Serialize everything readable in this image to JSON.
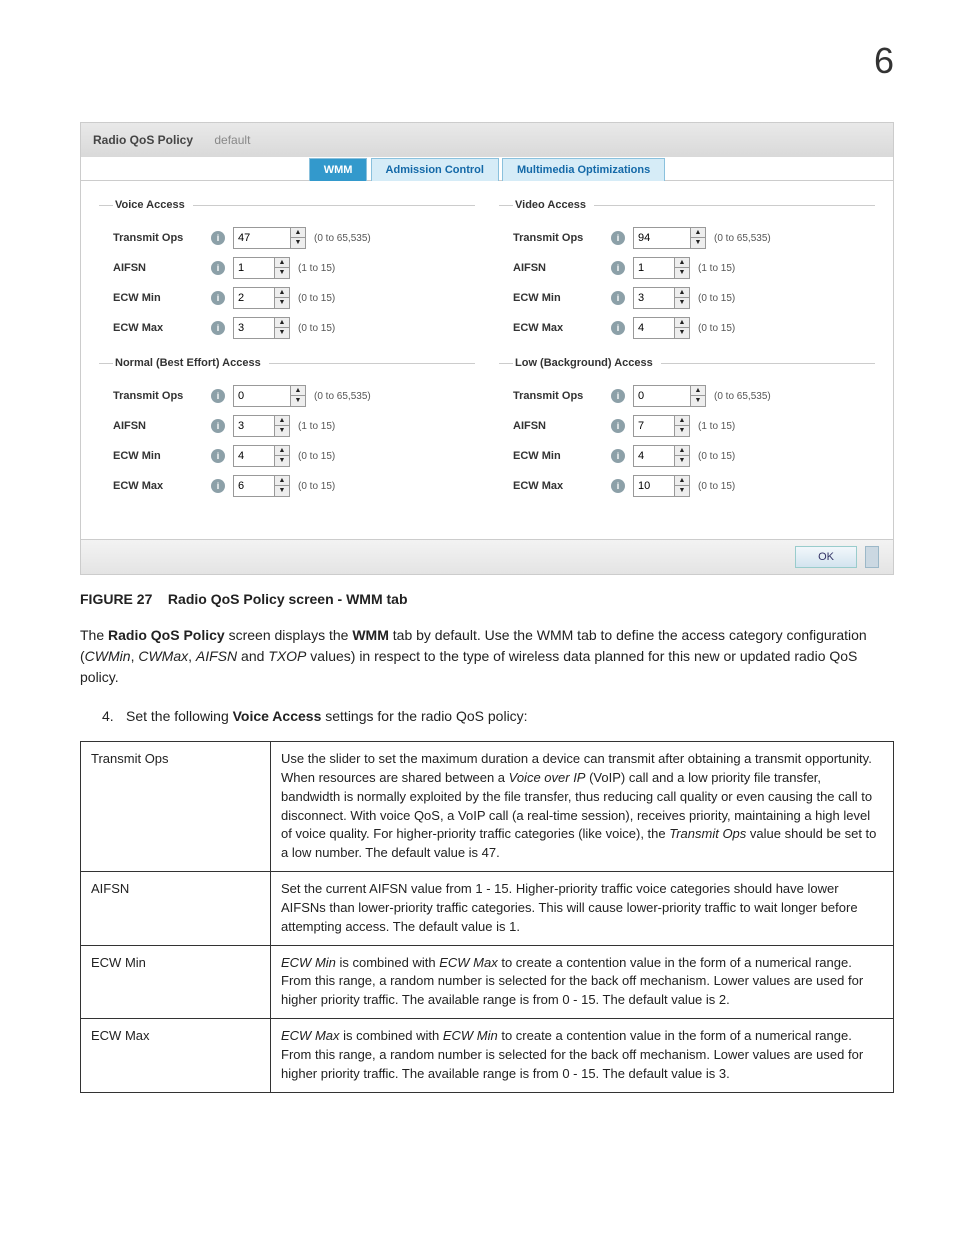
{
  "page_number": "6",
  "screenshot": {
    "title_label": "Radio QoS Policy",
    "title_value": "default",
    "tabs": {
      "wmm": "WMM",
      "admission": "Admission Control",
      "multimedia": "Multimedia Optimizations"
    },
    "hints": {
      "r65535": "(0 to 65,535)",
      "r15_1": "(1 to 15)",
      "r15_0": "(0 to 15)"
    },
    "legends": {
      "voice": "Voice Access",
      "normal": "Normal (Best Effort) Access",
      "video": "Video Access",
      "low": "Low (Background) Access"
    },
    "labels": {
      "transmit": "Transmit Ops",
      "aifsn": "AIFSN",
      "ecwmin": "ECW Min",
      "ecwmax": "ECW Max"
    },
    "values": {
      "voice": {
        "transmit": "47",
        "aifsn": "1",
        "ecwmin": "2",
        "ecwmax": "3"
      },
      "normal": {
        "transmit": "0",
        "aifsn": "3",
        "ecwmin": "4",
        "ecwmax": "6"
      },
      "video": {
        "transmit": "94",
        "aifsn": "1",
        "ecwmin": "3",
        "ecwmax": "4"
      },
      "low": {
        "transmit": "0",
        "aifsn": "7",
        "ecwmin": "4",
        "ecwmax": "10"
      }
    },
    "ok_button": "OK"
  },
  "figure": {
    "label": "FIGURE 27",
    "caption": "Radio QoS Policy screen - WMM tab"
  },
  "paragraph": {
    "p1a": "The ",
    "p1b": "Radio QoS Policy",
    "p1c": " screen displays the ",
    "p1d": "WMM",
    "p1e": " tab by default. Use the WMM tab to define the access category configuration (",
    "p1f": "CWMin",
    "p1g": ", ",
    "p1h": "CWMax",
    "p1i": ", ",
    "p1j": "AIFSN",
    "p1k": " and ",
    "p1l": "TXOP",
    "p1m": " values) in respect to the type of wireless data planned for this new or updated radio QoS policy."
  },
  "step4": {
    "num": "4.",
    "a": "Set the following ",
    "b": "Voice Access",
    "c": " settings for the radio QoS policy:"
  },
  "table": {
    "r1": {
      "term": "Transmit Ops",
      "a": "Use the slider to set the maximum duration a device can transmit after obtaining a transmit opportunity. When resources are shared between a ",
      "b": "Voice over IP",
      "c": " (VoIP) call and a low priority file transfer, bandwidth is normally exploited by the file transfer, thus reducing call quality or even causing the call to disconnect. With voice QoS, a VoIP call (a real-time session), receives priority, maintaining a high level of voice quality. For higher-priority traffic categories (like voice), the ",
      "d": "Transmit Ops",
      "e": " value should be set to a low number. The default value is 47."
    },
    "r2": {
      "term": "AIFSN",
      "text": "Set the current AIFSN value from 1 - 15. Higher-priority traffic voice categories should have lower AIFSNs than lower-priority traffic categories. This will cause lower-priority traffic to wait longer before attempting access. The default value is 1."
    },
    "r3": {
      "term": "ECW Min",
      "a": "ECW Min",
      "b": " is combined with ",
      "c": "ECW Max",
      "d": " to create a contention value in the form of a numerical range. From this range, a random number is selected for the back off mechanism. Lower values are used for higher priority traffic. The available range is from 0 - 15. The default value is 2."
    },
    "r4": {
      "term": "ECW Max",
      "a": "ECW Max",
      "b": " is combined with ",
      "c": "ECW Min",
      "d": " to create a contention value in the form of a numerical range. From this range, a random number is selected for the back off mechanism. Lower values are used for higher priority traffic. The available range is from 0 - 15. The default value is 3."
    }
  }
}
